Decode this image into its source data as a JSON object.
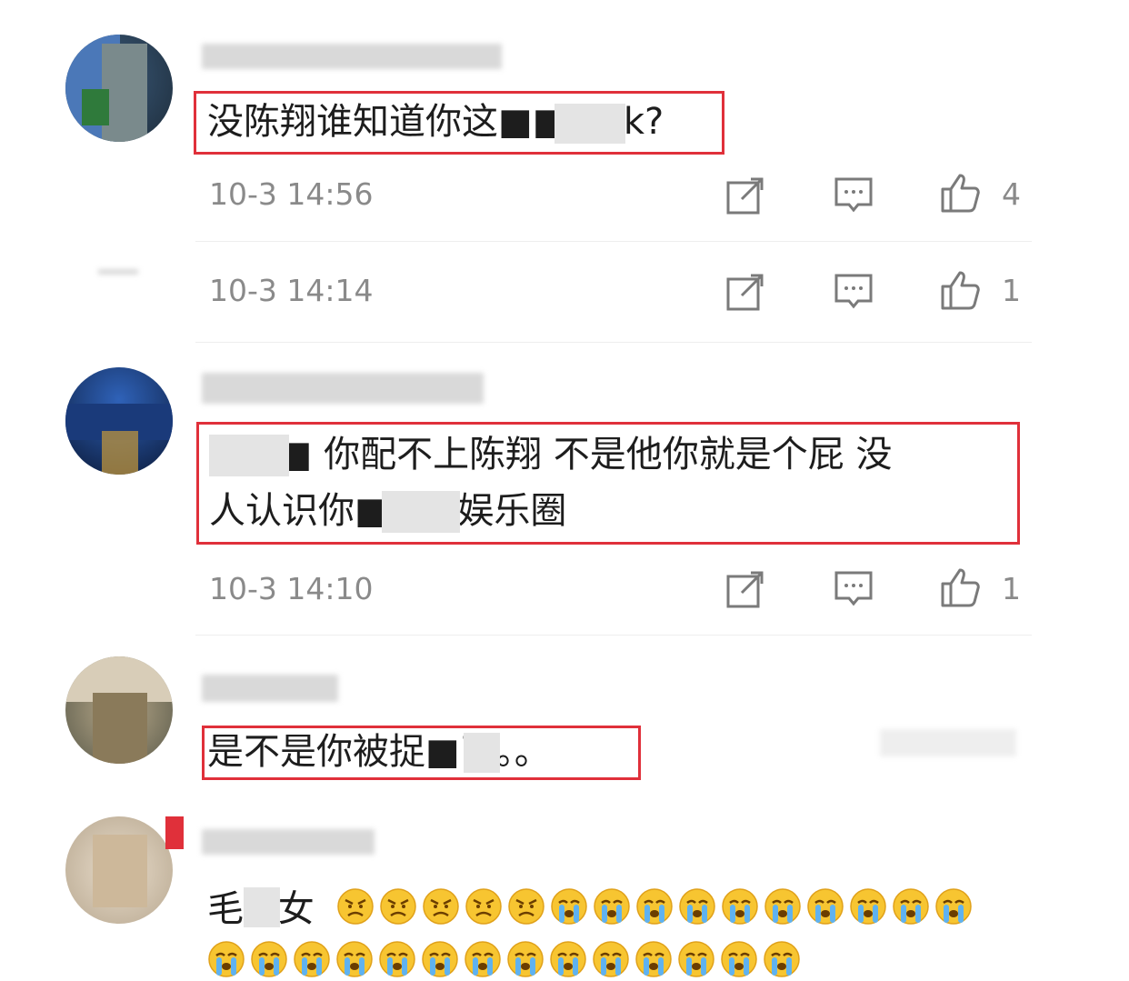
{
  "comments": [
    {
      "text": "没陈翔谁知道你这■■■ok?",
      "time": "10-3 14:56",
      "likes": "4"
    },
    {
      "text": "",
      "time": "10-3 14:14",
      "likes": "1"
    },
    {
      "text_line1": "■■■  你配不上陈翔  不是他你就是个屁  没",
      "text_line2": "人认识你■■■娱乐圈",
      "time": "10-3 14:10",
      "likes": "1"
    },
    {
      "text": "是不是你被捉■了。。"
    },
    {
      "text_prefix": "毛■女",
      "emoji_row1_count": "15",
      "emoji_row2_count": "14"
    }
  ],
  "colors": {
    "highlight_border": "#e0303a",
    "meta_text": "#8a8a8a"
  },
  "icons": [
    "share-icon",
    "comment-icon",
    "like-icon"
  ]
}
